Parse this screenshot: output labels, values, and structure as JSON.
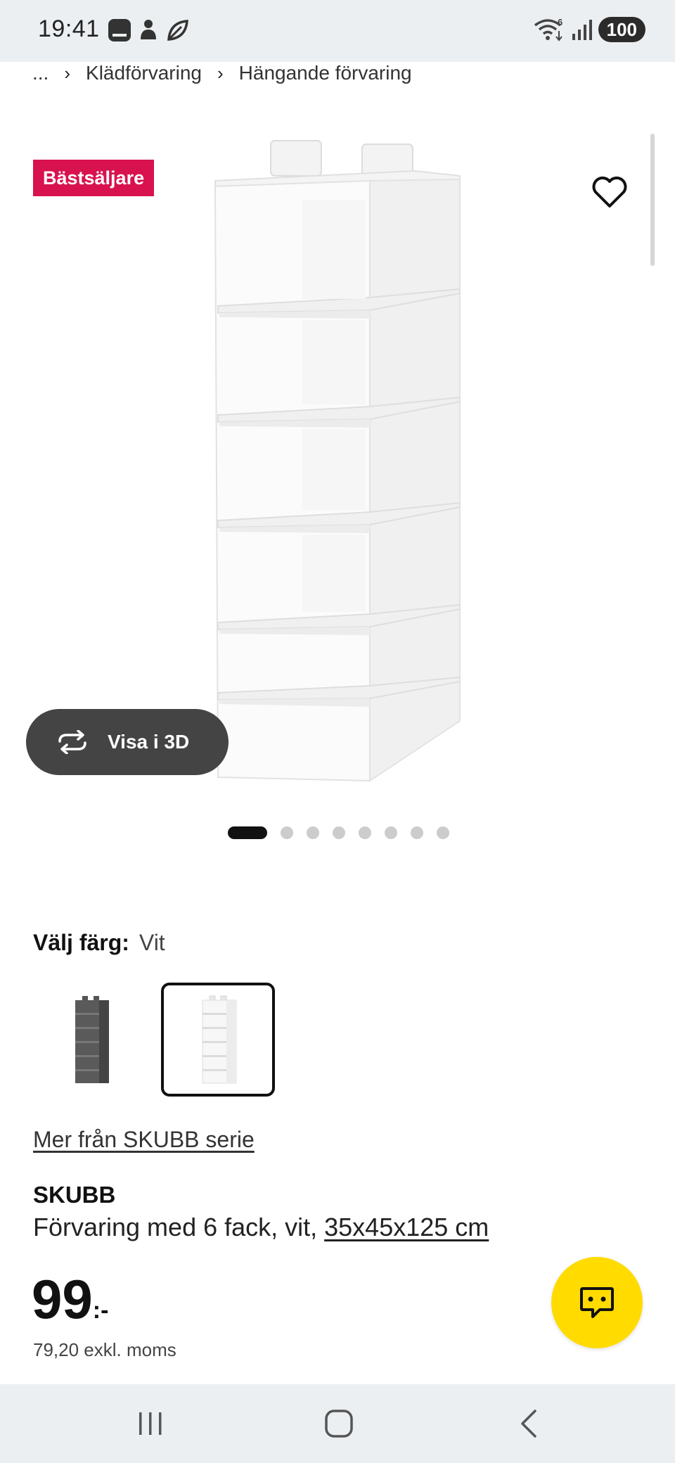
{
  "status_bar": {
    "time": "19:41",
    "battery": "100",
    "network_badge": "6"
  },
  "breadcrumb": {
    "ellipsis": "...",
    "items": [
      "Klädförvaring",
      "Hängande förvaring"
    ]
  },
  "gallery": {
    "badge": "Bästsäljare",
    "view_3d_label": "Visa i 3D",
    "image_count": 8,
    "active_index": 0
  },
  "color_select": {
    "label": "Välj färg:",
    "value": "Vit",
    "swatches": [
      "grey",
      "white"
    ],
    "selected_index": 1
  },
  "series_link": "Mer från SKUBB serie",
  "product": {
    "name": "SKUBB",
    "description": "Förvaring med 6 fack, vit, ",
    "dimensions": "35x45x125 cm",
    "price": "99",
    "price_suffix": ":-",
    "price_excl_vat": "79,20 exkl. moms"
  },
  "colors": {
    "badge": "#d8124f",
    "chat": "#ffdb00",
    "button_3d": "#444444"
  },
  "icons": [
    "heart-icon",
    "rotate-3d-icon",
    "chat-icon",
    "recent-apps-icon",
    "home-icon",
    "back-icon"
  ]
}
